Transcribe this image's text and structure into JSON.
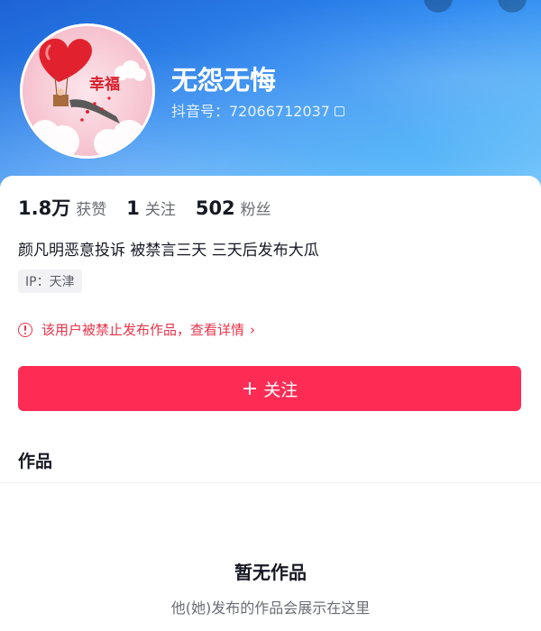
{
  "profile": {
    "nickname": "无怨无悔",
    "douyin_id": "抖音号：72066712037",
    "avatar_text": "幸福"
  },
  "stats": [
    {
      "value": "1.8万",
      "label": "获赞"
    },
    {
      "value": "1",
      "label": "关注"
    },
    {
      "value": "502",
      "label": "粉丝"
    }
  ],
  "bio": "颜凡明恶意投诉 被禁言三天 三天后发布大瓜",
  "ip_label": "IP：天津",
  "warning": {
    "text": "该用户被禁止发布作品，查看详情",
    "chevron": "›"
  },
  "follow_button": {
    "plus": "+",
    "label": "关注"
  },
  "tabs": {
    "works": "作品"
  },
  "empty_state": {
    "title": "暂无作品",
    "subtitle": "他(她)发布的作品会展示在这里"
  },
  "colors": {
    "accent": "#fe2c55",
    "warning": "#e8334a",
    "header": "#2f8af0"
  }
}
